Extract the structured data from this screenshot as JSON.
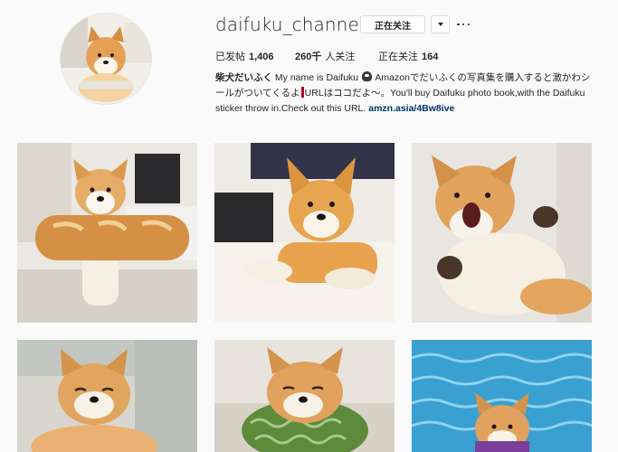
{
  "profile": {
    "username": "daifuku_channel",
    "follow_label": "正在关注",
    "avatar_icon": "shiba-avatar"
  },
  "stats": {
    "posts_label": "已发帖",
    "posts_value": "1,406",
    "followers_value": "260千",
    "followers_label": "人关注",
    "following_label": "正在关注",
    "following_value": "164"
  },
  "bio": {
    "name": "柴犬だいふく",
    "text1": "My name is Daifuku",
    "text2": "Amazonでだいふくの写真集を購入すると激かわシールがついてくるよ",
    "text3": "URLはココだよ～。You'll buy Daifuku photo book,with the Daifuku sticker throw in.Check out this URL.",
    "link": "amzn.asia/4Bw8ive"
  },
  "posts": [
    {
      "name": "post-shiba-bread"
    },
    {
      "name": "post-shiba-couch"
    },
    {
      "name": "post-shiba-yawn"
    },
    {
      "name": "post-shiba-sleepy"
    },
    {
      "name": "post-shiba-cushion"
    },
    {
      "name": "post-shiba-pool"
    }
  ]
}
